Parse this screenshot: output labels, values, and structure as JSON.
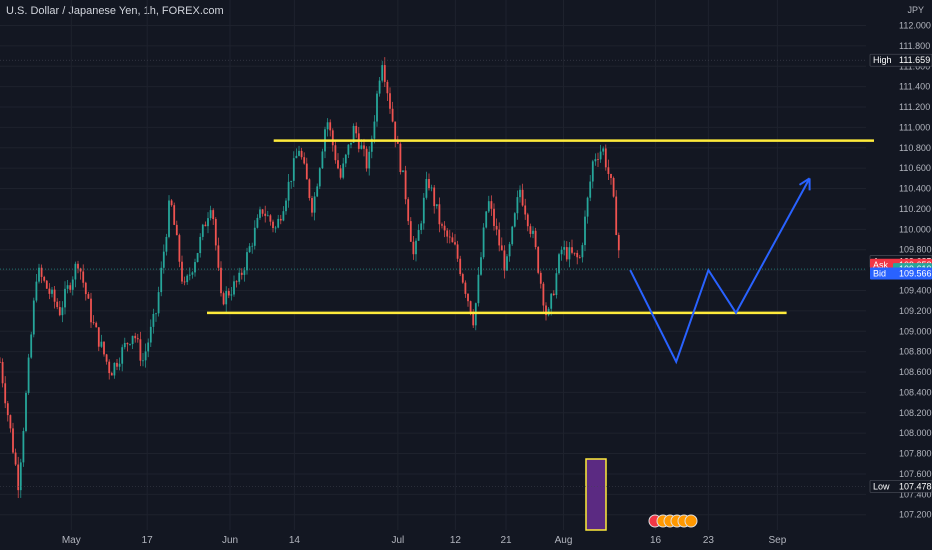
{
  "header": {
    "symbol_title": "U.S. Dollar / Japanese Yen, 1h, FOREX.com",
    "currency": "JPY"
  },
  "chart_data": {
    "type": "candlestick",
    "title": "U.S. Dollar / Japanese Yen, 1h, FOREX.com",
    "ylim": [
      107.05,
      112.25
    ],
    "y_ticks": [
      107.2,
      107.4,
      107.6,
      107.8,
      108.0,
      108.2,
      108.4,
      108.6,
      108.8,
      109.0,
      109.2,
      109.4,
      109.6,
      109.8,
      110.0,
      110.2,
      110.4,
      110.6,
      110.8,
      111.0,
      111.2,
      111.4,
      111.6,
      111.8,
      112.0
    ],
    "y_tick_labels": [
      "107.200",
      "107.400",
      "107.600",
      "107.800",
      "108.000",
      "108.200",
      "108.400",
      "108.600",
      "108.800",
      "109.000",
      "109.200",
      "109.400",
      "109.600",
      "109.800",
      "110.000",
      "110.200",
      "110.400",
      "110.600",
      "110.800",
      "111.000",
      "111.200",
      "111.400",
      "111.600",
      "111.800",
      "112.000"
    ],
    "x_labels": [
      "May",
      "17",
      "Jun",
      "14",
      "Jul",
      "12",
      "21",
      "Aug",
      "16",
      "23",
      "Sep"
    ],
    "price_path": [
      [
        0,
        108.7
      ],
      [
        0.04,
        107.5
      ],
      [
        0.08,
        109.6
      ],
      [
        0.13,
        109.2
      ],
      [
        0.17,
        109.7
      ],
      [
        0.2,
        109.1
      ],
      [
        0.24,
        108.6
      ],
      [
        0.29,
        109.0
      ],
      [
        0.31,
        108.7
      ],
      [
        0.34,
        109.2
      ],
      [
        0.37,
        110.3
      ],
      [
        0.4,
        109.4
      ],
      [
        0.43,
        109.8
      ],
      [
        0.46,
        110.3
      ],
      [
        0.48,
        109.3
      ],
      [
        0.52,
        109.5
      ],
      [
        0.57,
        110.2
      ],
      [
        0.6,
        110.0
      ],
      [
        0.65,
        110.8
      ],
      [
        0.68,
        110.2
      ],
      [
        0.71,
        111.1
      ],
      [
        0.74,
        110.5
      ],
      [
        0.77,
        111.0
      ],
      [
        0.8,
        110.6
      ],
      [
        0.83,
        111.7
      ],
      [
        0.86,
        110.9
      ],
      [
        0.88,
        110.4
      ],
      [
        0.9,
        109.7
      ],
      [
        0.93,
        110.5
      ],
      [
        0.96,
        110.0
      ],
      [
        0.99,
        109.8
      ],
      [
        1.03,
        109.1
      ],
      [
        1.06,
        110.3
      ],
      [
        1.1,
        109.6
      ],
      [
        1.13,
        110.4
      ],
      [
        1.16,
        109.9
      ],
      [
        1.19,
        109.1
      ],
      [
        1.22,
        109.8
      ],
      [
        1.26,
        109.7
      ],
      [
        1.29,
        110.7
      ],
      [
        1.31,
        110.8
      ],
      [
        1.33,
        110.4
      ],
      [
        1.35,
        109.61
      ]
    ],
    "annotations": {
      "resistance": {
        "value": 110.87,
        "x_start": 0.595,
        "x_end": 1.9
      },
      "support": {
        "value": 109.18,
        "x_start": 0.45,
        "x_end": 1.71
      },
      "projection": [
        [
          1.37,
          109.6
        ],
        [
          1.47,
          108.7
        ],
        [
          1.54,
          109.6
        ],
        [
          1.6,
          109.18
        ],
        [
          1.76,
          110.5
        ]
      ]
    },
    "price_labels": [
      {
        "name": "High",
        "value": "111.659",
        "y": 111.659,
        "color": "#131722"
      },
      {
        "name": "Avg",
        "value": "109.685",
        "y": 109.685,
        "color": "#131722"
      },
      {
        "name": "Ask",
        "value": "109.652",
        "y": 109.652,
        "color": "#f23645"
      },
      {
        "name": "",
        "value": "109.610",
        "y": 109.61,
        "color": "#26a69a"
      },
      {
        "name": "Bid",
        "value": "109.566",
        "y": 109.566,
        "color": "#2962ff"
      },
      {
        "name": "Low",
        "value": "107.478",
        "y": 107.478,
        "color": "#131722"
      }
    ],
    "grid": true
  }
}
